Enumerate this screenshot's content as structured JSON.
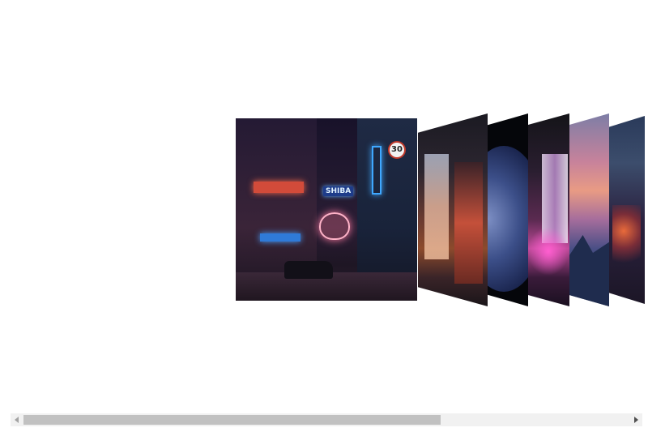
{
  "slider": {
    "slides": [
      {
        "name": "street-night",
        "signs": [
          "SHIBA",
          "30"
        ]
      },
      {
        "name": "alley-lights"
      },
      {
        "name": "planet"
      },
      {
        "name": "neon-arcade"
      },
      {
        "name": "mountain-sunset"
      },
      {
        "name": "city-night"
      }
    ]
  },
  "scrollbar": {
    "position": 0.0,
    "visible_fraction": 0.67
  }
}
